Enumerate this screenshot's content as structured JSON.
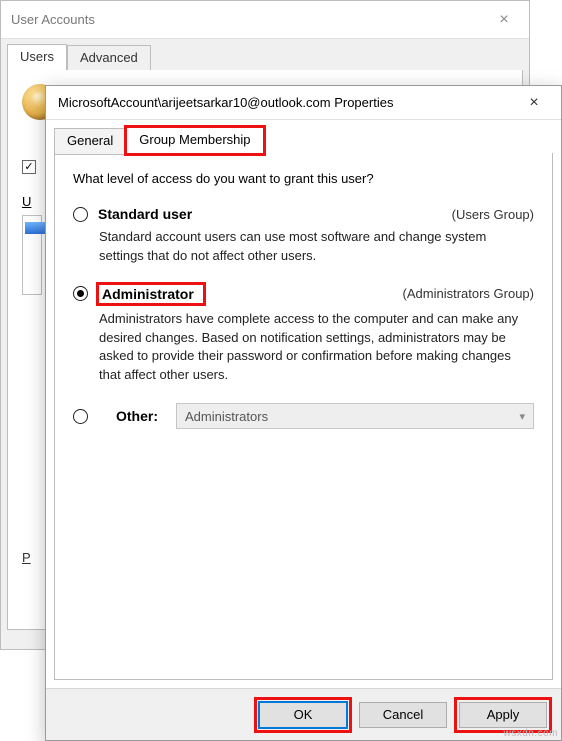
{
  "parent": {
    "title": "User Accounts",
    "tabs": {
      "users": "Users",
      "advanced": "Advanced"
    },
    "checkbox_checked_glyph": "✓",
    "users_label_letter": "U",
    "password_label_letter": "P"
  },
  "child": {
    "title": "MicrosoftAccount\\arijeetsarkar10@outlook.com Properties",
    "tabs": {
      "general": "General",
      "group": "Group Membership"
    },
    "prompt": "What level of access do you want to grant this user?",
    "options": {
      "standard": {
        "label": "Standard user",
        "group": "(Users Group)",
        "desc": "Standard account users can use most software and change system settings that do not affect other users."
      },
      "admin": {
        "label": "Administrator",
        "group": "(Administrators Group)",
        "desc": "Administrators have complete access to the computer and can make any desired changes. Based on notification settings, administrators may be asked to provide their password or confirmation before making changes that affect other users."
      },
      "other": {
        "label": "Other:",
        "selected": "Administrators"
      }
    },
    "buttons": {
      "ok": "OK",
      "cancel": "Cancel",
      "apply": "Apply"
    }
  },
  "watermark": "wsxdn.com"
}
